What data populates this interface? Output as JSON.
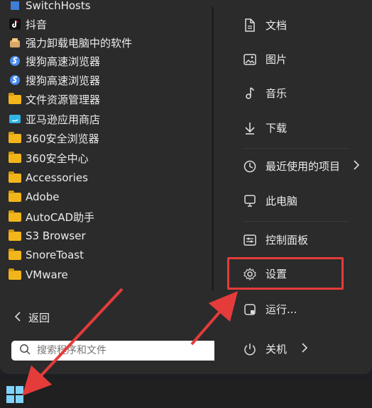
{
  "apps": [
    {
      "label": "SwitchHosts",
      "icon": "switchhosts-icon"
    },
    {
      "label": "抖音",
      "icon": "tiktok-icon"
    },
    {
      "label": "强力卸载电脑中的软件",
      "icon": "uninstaller-icon"
    },
    {
      "label": "搜狗高速浏览器",
      "icon": "sogou-browser-icon"
    },
    {
      "label": "搜狗高速浏览器",
      "icon": "sogou-browser-icon"
    },
    {
      "label": "文件资源管理器",
      "icon": "folder-icon"
    },
    {
      "label": "亚马逊应用商店",
      "icon": "amazon-appstore-icon"
    },
    {
      "label": "360安全浏览器",
      "icon": "folder-icon"
    },
    {
      "label": "360安全中心",
      "icon": "folder-icon"
    },
    {
      "label": "Accessories",
      "icon": "folder-icon"
    },
    {
      "label": "Adobe",
      "icon": "folder-icon"
    },
    {
      "label": "AutoCAD助手",
      "icon": "folder-icon"
    },
    {
      "label": "S3 Browser",
      "icon": "folder-icon"
    },
    {
      "label": "SnoreToast",
      "icon": "folder-icon"
    },
    {
      "label": "VMware",
      "icon": "folder-icon"
    }
  ],
  "back": {
    "label": "返回"
  },
  "search": {
    "placeholder": "搜索程序和文件"
  },
  "right_items": [
    {
      "label": "文档",
      "icon": "document-icon"
    },
    {
      "label": "图片",
      "icon": "picture-icon"
    },
    {
      "label": "音乐",
      "icon": "music-icon"
    },
    {
      "label": "下载",
      "icon": "download-icon"
    },
    {
      "label": "最近使用的项目",
      "icon": "recent-icon"
    },
    {
      "label": "此电脑",
      "icon": "computer-icon"
    },
    {
      "label": "控制面板",
      "icon": "control-panel-icon"
    },
    {
      "label": "设置",
      "icon": "settings-icon"
    },
    {
      "label": "运行...",
      "icon": "run-icon"
    },
    {
      "label": "关机",
      "icon": "power-icon"
    }
  ],
  "colors": {
    "highlight": "#e53b3b",
    "arrow": "#e53b3b",
    "start_icon": "#7fd3ff"
  }
}
